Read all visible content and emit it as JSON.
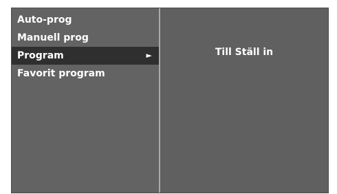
{
  "menu": {
    "items": [
      {
        "label": "Auto-prog",
        "selected": false
      },
      {
        "label": "Manuell prog",
        "selected": false
      },
      {
        "label": "Program",
        "selected": true,
        "arrow": "►"
      },
      {
        "label": "Favorit program",
        "selected": false
      }
    ]
  },
  "submenu": {
    "label": "Till Ställ in"
  },
  "colors": {
    "panel_bg": "#606060",
    "selected_bg": "#2f2f2f",
    "divider": "#ababab",
    "text": "#ffffff"
  }
}
